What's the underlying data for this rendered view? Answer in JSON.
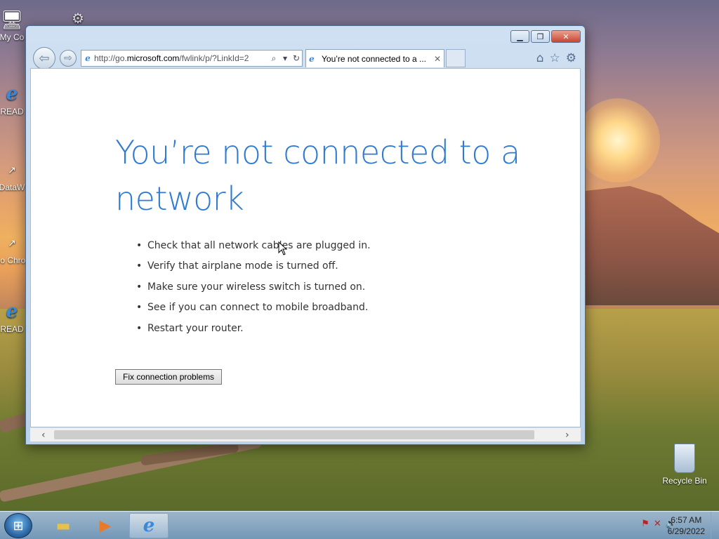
{
  "desktop": {
    "icons": [
      {
        "label": "My Co"
      },
      {
        "label": "READ"
      },
      {
        "label": "DataW"
      },
      {
        "label": "Go Chron"
      },
      {
        "label": "READ"
      }
    ],
    "recycle_bin": "Recycle Bin"
  },
  "browser": {
    "address_url_prefix": "http://go.",
    "address_url_domain": "microsoft.com",
    "address_url_rest": "/fwlink/p/?LinkId=2",
    "tab_title": "You’re not connected to a ...",
    "icons": {
      "back": "back-arrow-icon",
      "forward": "forward-arrow-icon",
      "home": "home-icon",
      "favorites": "star-icon",
      "settings": "gear-icon"
    }
  },
  "page": {
    "heading": "You’re not connected to a network",
    "tips": [
      "Check that all network cables are plugged in.",
      "Verify that airplane mode is turned off.",
      "Make sure your wireless switch is turned on.",
      "See if you can connect to mobile broadband.",
      "Restart your router."
    ],
    "fix_button": "Fix connection problems"
  },
  "taskbar": {
    "time": "6:57 AM",
    "date": "6/29/2022"
  }
}
